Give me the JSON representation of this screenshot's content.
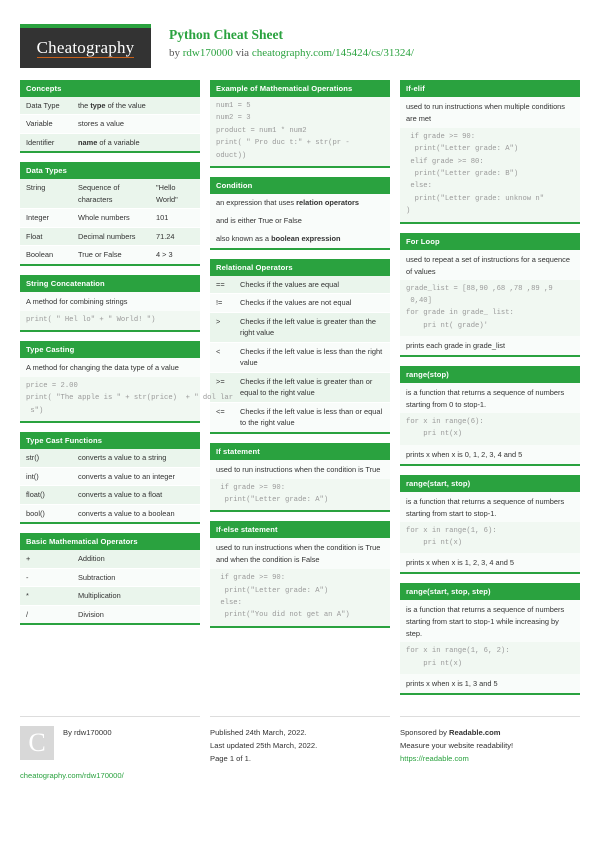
{
  "header": {
    "logo_text": "Cheatography",
    "title": "Python Cheat Sheet",
    "by_prefix": "by ",
    "author": "rdw170000",
    "via": " via ",
    "source_url": "cheatography.com/145424/cs/31324/"
  },
  "columns": [
    {
      "cards": [
        {
          "title": "Concepts",
          "type": "kv",
          "rows": [
            {
              "key": "Data Type",
              "value": "the <b>type</b> of the value"
            },
            {
              "key": "Variable",
              "value": "stores a value"
            },
            {
              "key": "Identifier",
              "value": "<b>name</b> of a variable"
            }
          ]
        },
        {
          "title": "Data Types",
          "type": "triple",
          "rows": [
            {
              "key": "String",
              "mid": "Sequence of characters",
              "end": "\"Hello World\""
            },
            {
              "key": "Integer",
              "mid": "Whole numbers",
              "end": "101"
            },
            {
              "key": "Float",
              "mid": "Decimal numbers",
              "end": "71.24"
            },
            {
              "key": "Boolean",
              "mid": "True or False",
              "end": "4 > 3"
            }
          ]
        },
        {
          "title": "String Concatenation",
          "type": "textcode",
          "text": "A method for combining strings",
          "code": "print( \" Hel lo\" + \" World! \")"
        },
        {
          "title": "Type Casting",
          "type": "textcode",
          "text": "A method for changing the data type of a value",
          "code": "price = 2.00\nprint( \"The apple is \" + str(price)  + \" dol lar\n s\")"
        },
        {
          "title": "Type Cast Functions",
          "type": "kv",
          "rows": [
            {
              "key": "str()",
              "value": "converts a value to a string"
            },
            {
              "key": "int()",
              "value": "converts a value to an integer"
            },
            {
              "key": "float()",
              "value": "converts a value to a float"
            },
            {
              "key": "bool()",
              "value": "converts a value to a boolean"
            }
          ]
        },
        {
          "title": "Basic Mathematical Operators",
          "type": "kv",
          "rows": [
            {
              "key": "+",
              "value": "Addition"
            },
            {
              "key": "-",
              "value": "Subtraction"
            },
            {
              "key": "*",
              "value": "Multiplication"
            },
            {
              "key": "/",
              "value": "Division"
            }
          ]
        }
      ]
    },
    {
      "cards": [
        {
          "title": "Example of Mathematical Operations",
          "type": "codeonly",
          "code": "num1 = 5\nnum2 = 3\nproduct = num1 * num2\nprint( \" Pro duc t:\" + str(pr -\noduct))"
        },
        {
          "title": "Condition",
          "type": "lines",
          "lines": [
            "an expression that uses <b>relation operators</b>",
            "and is either True or False",
            "also known as a <b>boolean expression</b>"
          ]
        },
        {
          "title": "Relational Operators",
          "type": "ops",
          "rows": [
            {
              "op": "==",
              "desc": "Checks if the values are equal"
            },
            {
              "op": "!=",
              "desc": "Checks if the values are not equal"
            },
            {
              "op": ">",
              "desc": "Checks if the left value is greater than the right value"
            },
            {
              "op": "<",
              "desc": "Checks if the left value is less than the right value"
            },
            {
              "op": ">=",
              "desc": "Checks if the left value is greater than or equal to the right value"
            },
            {
              "op": "<=",
              "desc": "Checks if the left value is less than or equal to the right value"
            }
          ]
        },
        {
          "title": "If statement",
          "type": "textcode",
          "text": "used to run instructions when the condition is True",
          "code": " if grade >= 90:\n  print(\"Letter grade: A\")"
        },
        {
          "title": "If-else statement",
          "type": "textcode",
          "text": "used to run instructions when the condition is True and when the condition is False",
          "code": " if grade >= 90:\n  print(\"Letter grade: A\")\n else:\n  print(\"You did not get an A\")"
        }
      ]
    },
    {
      "cards": [
        {
          "title": "If-elif",
          "type": "textcode",
          "text": "used to run instructions when multiple conditions are met",
          "code": " if grade >= 90:\n  print(\"Letter grade: A\")\n elif grade >= 80:\n  print(\"Letter grade: B\")\n else:\n  print(\"Letter grade: unknow n\"\n)"
        },
        {
          "title": "For Loop",
          "type": "textcodetext",
          "text": "used to repeat a set of instructions for a sequence of values",
          "code": "grade_list = [88,90 ,68 ,78 ,89 ,9\n 0,40]\nfor grade in grade_ list:\n    pri nt( grade)'",
          "footer": "prints each grade in grade_list"
        },
        {
          "title": "range(stop)",
          "type": "textcodetext",
          "text": "is a function that returns a sequence of numbers starting from 0 to stop-1.",
          "code": "for x in range(6):\n    pri nt(x)",
          "footer": "prints x when x is 0, 1, 2, 3, 4 and 5"
        },
        {
          "title": "range(start, stop)",
          "type": "textcodetext",
          "text": "is a function that returns a sequence of numbers starting from start to stop-1.",
          "code": "for x in range(1, 6):\n    pri nt(x)",
          "footer": "prints x when x is 1, 2, 3, 4 and 5"
        },
        {
          "title": "range(start, stop, step)",
          "type": "textcodetext",
          "text": "is a function that returns a sequence of numbers starting from start to stop-1 while increasing by step.",
          "code": "for x in range(1, 6, 2):\n    pri nt(x)",
          "footer": "prints x when x is 1, 3 and 5"
        }
      ]
    }
  ],
  "footer": {
    "avatar_letter": "C",
    "by_label": "By rdw170000",
    "profile_link": "cheatography.com/rdw170000/",
    "published": "Published 24th March, 2022.",
    "updated": "Last updated 25th March, 2022.",
    "page": "Page 1 of 1.",
    "sponsor_prefix": "Sponsored by ",
    "sponsor_name": "Readable.com",
    "sponsor_tagline": "Measure your website readability!",
    "sponsor_link": "https://readable.com"
  }
}
